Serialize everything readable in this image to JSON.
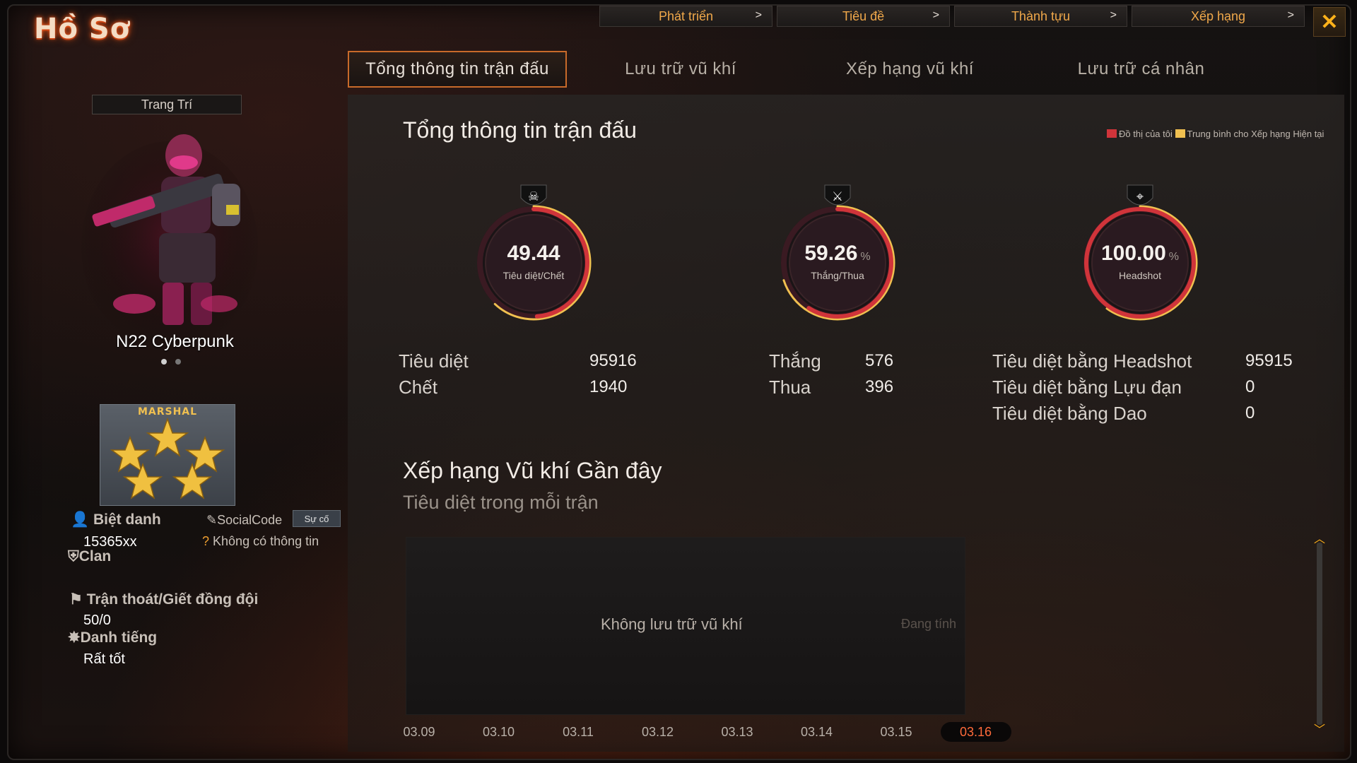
{
  "window": {
    "title": "Hồ Sơ",
    "close_label": "✕"
  },
  "top_nav": [
    {
      "label": "Phát triển"
    },
    {
      "label": "Tiêu đề"
    },
    {
      "label": "Thành tựu"
    },
    {
      "label": "Xếp hạng"
    }
  ],
  "sub_tabs": [
    {
      "label": "Tổng thông tin trận đấu",
      "active": true
    },
    {
      "label": "Lưu trữ vũ khí",
      "active": false
    },
    {
      "label": "Xếp hạng vũ khí",
      "active": false
    },
    {
      "label": "Lưu trữ cá nhân",
      "active": false
    }
  ],
  "profile": {
    "decor_button": "Trang Trí",
    "character_name": "N22 Cyberpunk",
    "rank_title": "MARSHAL",
    "nickname_label": "Biệt danh",
    "nickname": "15365xx",
    "socialcode_label": "SocialCode",
    "socialcode_button": "Sự cố",
    "socialcode_value": "Không có thông tin",
    "clan_label": "Clan",
    "escape_label": "Trận thoát/Giết đồng đội",
    "escape_value": "50/0",
    "reputation_label": "Danh tiếng",
    "reputation_value": "Rất tốt"
  },
  "overview": {
    "title": "Tổng thông tin trận đấu",
    "legend_mine": "Đồ thị của tôi",
    "legend_avg": "Trung bình cho Xếp hạng Hiện tại",
    "colors": {
      "mine": "#d0343a",
      "avg": "#f0c050"
    },
    "gauges": [
      {
        "value": "49.44",
        "unit": "",
        "label": "Tiêu diệt/Chết",
        "icon": "skull-icon",
        "fill_mine": 0.49,
        "fill_avg": 0.62
      },
      {
        "value": "59.26",
        "unit": "%",
        "label": "Thắng/Thua",
        "icon": "crossed-swords-icon",
        "fill_mine": 0.59,
        "fill_avg": 0.7
      },
      {
        "value": "100.00",
        "unit": "%",
        "label": "Headshot",
        "icon": "crosshair-icon",
        "fill_mine": 1.0,
        "fill_avg": 0.6
      }
    ],
    "kd": {
      "kills_label": "Tiêu diệt",
      "kills": "95916",
      "deaths_label": "Chết",
      "deaths": "1940"
    },
    "wl": {
      "wins_label": "Thắng",
      "wins": "576",
      "losses_label": "Thua",
      "losses": "396"
    },
    "hs": {
      "headshot_label": "Tiêu diệt bằng Headshot",
      "headshot": "95915",
      "grenade_label": "Tiêu diệt bằng Lựu đạn",
      "grenade": "0",
      "knife_label": "Tiêu diệt bằng Dao",
      "knife": "0"
    }
  },
  "weapon_rank": {
    "title": "Xếp hạng Vũ khí Gần đây",
    "subtitle": "Tiêu diệt trong mỗi trận",
    "empty_text": "Không lưu trữ vũ khí",
    "loading_text": "Đang tính",
    "dates": [
      "03.09",
      "03.10",
      "03.11",
      "03.12",
      "03.13",
      "03.14",
      "03.15",
      "03.16"
    ],
    "active_date": "03.16"
  }
}
